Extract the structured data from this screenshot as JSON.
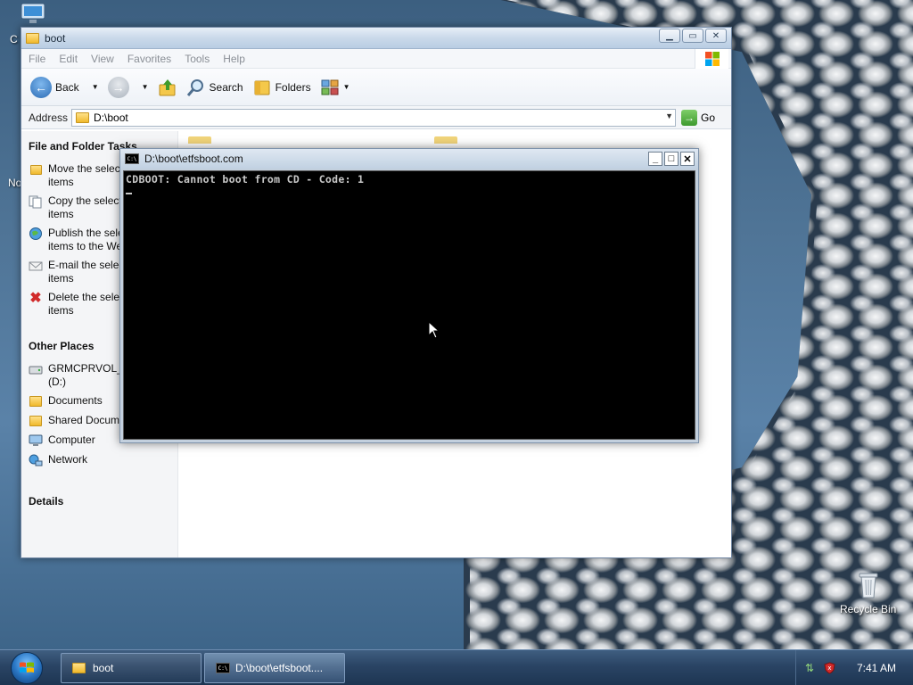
{
  "desktop": {
    "icons": [
      {
        "name": "recycle-bin",
        "label": "Recycle Bin"
      }
    ]
  },
  "explorer": {
    "title": "boot",
    "menu": [
      "File",
      "Edit",
      "View",
      "Favorites",
      "Tools",
      "Help"
    ],
    "toolbar": {
      "back_label": "Back",
      "search_label": "Search",
      "folders_label": "Folders"
    },
    "address": {
      "label": "Address",
      "value": "D:\\boot",
      "go_label": "Go"
    },
    "tasks": {
      "heading": "File and Folder Tasks",
      "items": [
        {
          "icon": "move-icon",
          "line1": "Move the selected",
          "line2": "items"
        },
        {
          "icon": "copy-icon",
          "line1": "Copy the selected",
          "line2": "items"
        },
        {
          "icon": "publish-icon",
          "line1": "Publish the selected",
          "line2": "items to the Web"
        },
        {
          "icon": "email-icon",
          "line1": "E-mail the selected",
          "line2": "items"
        },
        {
          "icon": "delete-icon",
          "line1": "Delete the selected",
          "line2": "items"
        }
      ]
    },
    "other_places": {
      "heading": "Other Places",
      "items": [
        {
          "icon": "drive-icon",
          "line1": "GRMCPRVOL_",
          "line2": "(D:)"
        },
        {
          "icon": "documents-icon",
          "line1": "Documents",
          "line2": ""
        },
        {
          "icon": "shared-folder-icon",
          "line1": "Shared Documents",
          "line2": ""
        },
        {
          "icon": "computer-icon",
          "line1": "Computer",
          "line2": ""
        },
        {
          "icon": "network-icon",
          "line1": "Network",
          "line2": ""
        }
      ]
    },
    "details_heading": "Details"
  },
  "console": {
    "title": "D:\\boot\\etfsboot.com",
    "icon_text": "C:\\",
    "output": "CDBOOT: Cannot boot from CD - Code: 1"
  },
  "taskbar": {
    "buttons": [
      {
        "label": "boot"
      },
      {
        "label": "D:\\boot\\etfsboot...."
      }
    ],
    "clock": "7:41 AM"
  },
  "colors": {
    "taskbar": "#2a4464",
    "console_bg": "#000000",
    "console_text": "#c8c8c8"
  }
}
